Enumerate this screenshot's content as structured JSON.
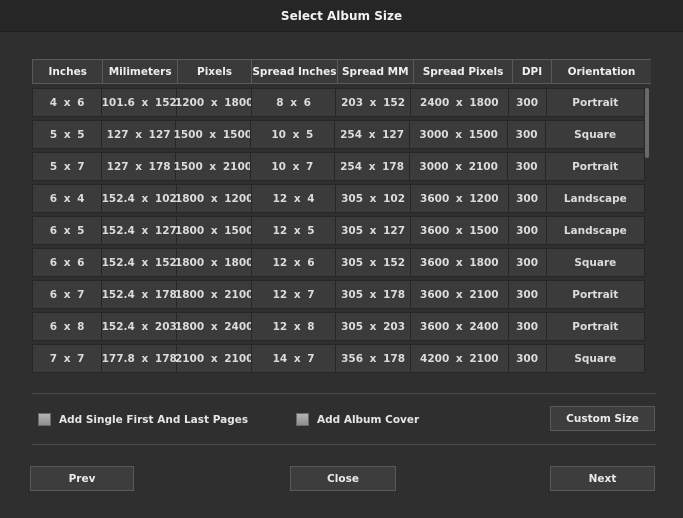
{
  "dialog": {
    "title": "Select Album Size"
  },
  "table": {
    "columns": [
      "Inches",
      "Milimeters",
      "Pixels",
      "Spread Inches",
      "Spread MM",
      "Spread Pixels",
      "DPI",
      "Orientation"
    ],
    "rows": [
      [
        "4 x 6",
        "101.6 x 152",
        "1200 x 1800",
        "8 x 6",
        "203 x 152",
        "2400 x 1800",
        "300",
        "Portrait"
      ],
      [
        "5 x 5",
        "127 x 127",
        "1500 x 1500",
        "10 x 5",
        "254 x 127",
        "3000 x 1500",
        "300",
        "Square"
      ],
      [
        "5 x 7",
        "127 x 178",
        "1500 x 2100",
        "10 x 7",
        "254 x 178",
        "3000 x 2100",
        "300",
        "Portrait"
      ],
      [
        "6 x 4",
        "152.4 x 102",
        "1800 x 1200",
        "12 x 4",
        "305 x 102",
        "3600 x 1200",
        "300",
        "Landscape"
      ],
      [
        "6 x 5",
        "152.4 x 127",
        "1800 x 1500",
        "12 x 5",
        "305 x 127",
        "3600 x 1500",
        "300",
        "Landscape"
      ],
      [
        "6 x 6",
        "152.4 x 152",
        "1800 x 1800",
        "12 x 6",
        "305 x 152",
        "3600 x 1800",
        "300",
        "Square"
      ],
      [
        "6 x 7",
        "152.4 x 178",
        "1800 x 2100",
        "12 x 7",
        "305 x 178",
        "3600 x 2100",
        "300",
        "Portrait"
      ],
      [
        "6 x 8",
        "152.4 x 203",
        "1800 x 2400",
        "12 x 8",
        "305 x 203",
        "3600 x 2400",
        "300",
        "Portrait"
      ],
      [
        "7 x 7",
        "177.8 x 178",
        "2100 x 2100",
        "14 x 7",
        "356 x 178",
        "4200 x 2100",
        "300",
        "Square"
      ]
    ]
  },
  "options": {
    "single_pages_label": "Add Single First And Last Pages",
    "single_pages_checked": false,
    "album_cover_label": "Add Album Cover",
    "album_cover_checked": false,
    "custom_size_label": "Custom Size"
  },
  "footer": {
    "prev_label": "Prev",
    "close_label": "Close",
    "next_label": "Next"
  },
  "colors": {
    "background": "#2f2f2f",
    "title_bar": "#262626",
    "cell": "#3b3b3b",
    "text": "#e6e6e6"
  }
}
